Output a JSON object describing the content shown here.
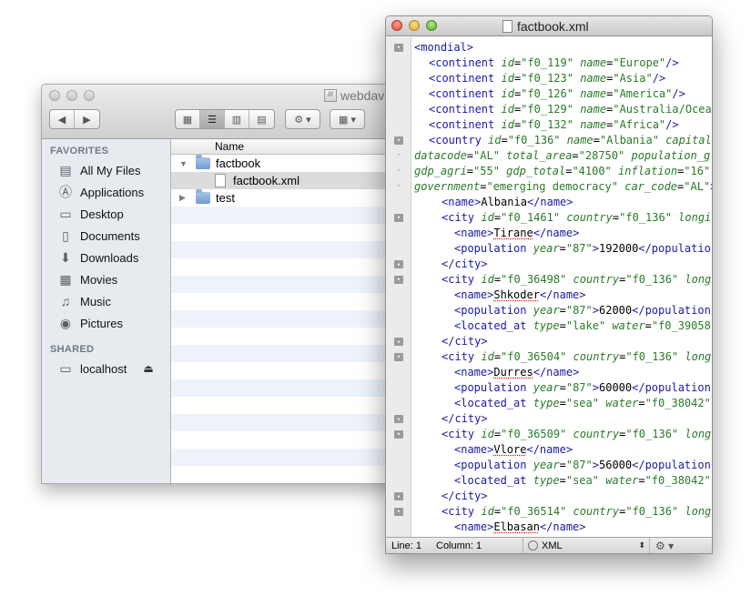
{
  "finder": {
    "title": "webdav",
    "toolbar": {
      "back": "◀",
      "forward": "▶",
      "views": [
        "▦",
        "☰",
        "▥",
        "▤"
      ],
      "action": "⚙ ▾",
      "arrange": "▦ ▾"
    },
    "sidebar": {
      "favorites_header": "FAVORITES",
      "favorites": [
        {
          "label": "All My Files",
          "icon": "all-files-icon",
          "glyph": "▤"
        },
        {
          "label": "Applications",
          "icon": "applications-icon",
          "glyph": "Ⓐ"
        },
        {
          "label": "Desktop",
          "icon": "desktop-icon",
          "glyph": "▭"
        },
        {
          "label": "Documents",
          "icon": "documents-icon",
          "glyph": "▯"
        },
        {
          "label": "Downloads",
          "icon": "downloads-icon",
          "glyph": "⬇"
        },
        {
          "label": "Movies",
          "icon": "movies-icon",
          "glyph": "▦"
        },
        {
          "label": "Music",
          "icon": "music-icon",
          "glyph": "♫"
        },
        {
          "label": "Pictures",
          "icon": "pictures-icon",
          "glyph": "◉"
        }
      ],
      "shared_header": "SHARED",
      "shared": [
        {
          "label": "localhost",
          "icon": "computer-icon",
          "glyph": "▭",
          "eject": "⏏"
        }
      ]
    },
    "list": {
      "column_name": "Name",
      "rows": [
        {
          "name": "factbook",
          "kind": "folder",
          "expanded": true
        },
        {
          "name": "factbook.xml",
          "kind": "file",
          "selected": true
        },
        {
          "name": "test",
          "kind": "folder",
          "expanded": false
        }
      ]
    }
  },
  "editor": {
    "title": "factbook.xml",
    "status": {
      "line": "Line: 1",
      "column": "Column: 1",
      "language": "XML",
      "updown": "⬍",
      "gear": "⚙ ▾"
    }
  }
}
